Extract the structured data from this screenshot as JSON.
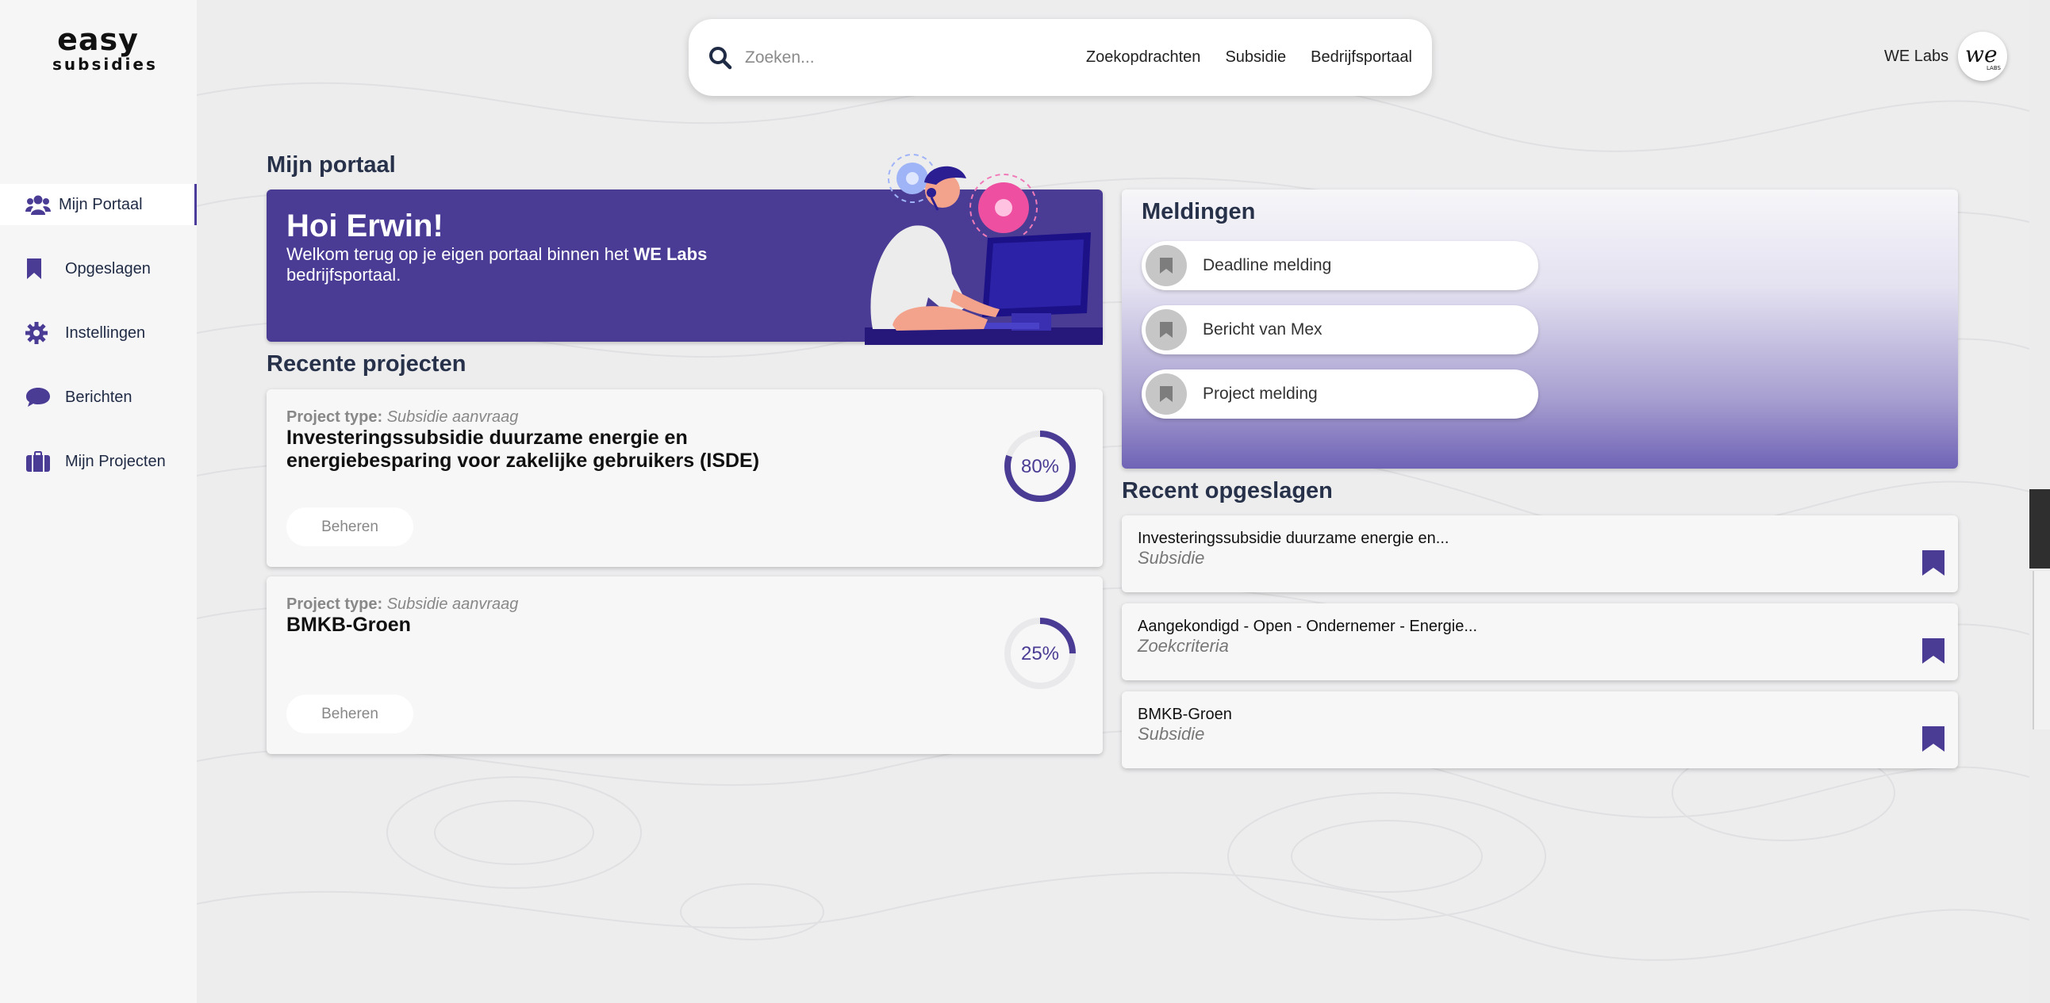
{
  "brand": {
    "logo_line1": "easy",
    "logo_line2": "subsidies"
  },
  "colors": {
    "accent": "#4a3c94",
    "sidebar_bg": "#f6f6f7",
    "page_bg": "#ededee"
  },
  "sidebar": {
    "items": [
      {
        "label": "Mijn Portaal",
        "icon": "users-icon",
        "active": true
      },
      {
        "label": "Opgeslagen",
        "icon": "bookmark-icon",
        "active": false
      },
      {
        "label": "Instellingen",
        "icon": "gear-icon",
        "active": false
      },
      {
        "label": "Berichten",
        "icon": "chat-bubble-icon",
        "active": false
      },
      {
        "label": "Mijn Projecten",
        "icon": "briefcase-icon",
        "active": false
      }
    ]
  },
  "topbar": {
    "search_placeholder": "Zoeken...",
    "links": [
      "Zoekopdrachten",
      "Subsidie",
      "Bedrijfsportaal"
    ],
    "user_name": "WE Labs",
    "avatar_text": "we"
  },
  "portal": {
    "title": "Mijn portaal",
    "greeting": "Hoi Erwin!",
    "welcome_pre": "Welkom terug op je eigen portaal binnen het ",
    "welcome_bold": "WE Labs",
    "welcome_post": " bedrijfsportaal."
  },
  "projects": {
    "title": "Recente projecten",
    "type_label": "Project type:",
    "button_label": "Beheren",
    "items": [
      {
        "type": "Subsidie aanvraag",
        "title": "Investeringssubsidie duurzame energie en energiebesparing voor zakelijke gebruikers (ISDE)",
        "progress": 0.8,
        "progress_label": "80%"
      },
      {
        "type": "Subsidie aanvraag",
        "title": "BMKB-Groen",
        "progress": 0.25,
        "progress_label": "25%"
      }
    ]
  },
  "notifications": {
    "title": "Meldingen",
    "items": [
      "Deadline melding",
      "Bericht van Mex",
      "Project melding"
    ]
  },
  "saved": {
    "title": "Recent opgeslagen",
    "items": [
      {
        "title": "Investeringssubsidie duurzame energie en...",
        "sub": "Subsidie"
      },
      {
        "title": "Aangekondigd - Open - Ondernemer - Energie...",
        "sub": "Zoekcriteria"
      },
      {
        "title": "BMKB-Groen",
        "sub": "Subsidie"
      }
    ]
  }
}
